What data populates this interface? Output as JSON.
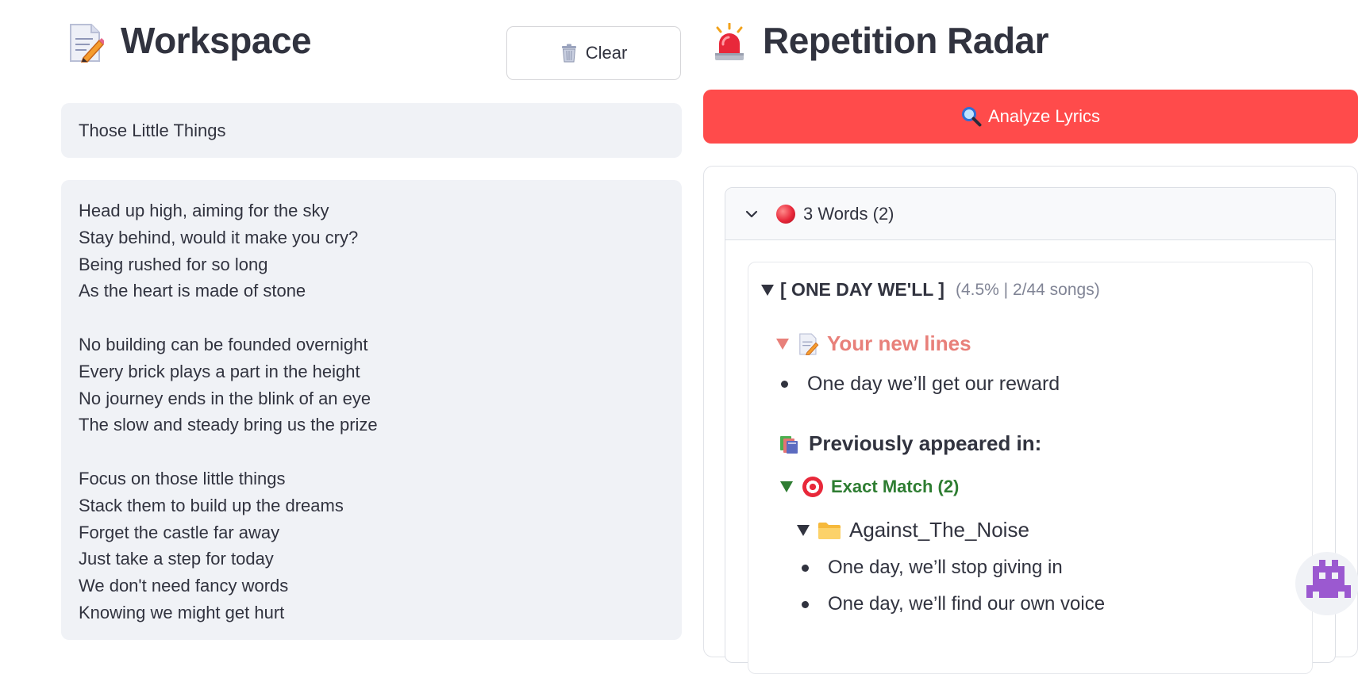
{
  "workspace": {
    "title": "Workspace",
    "icon": "memo-pencil-icon",
    "clear_label": "Clear",
    "song_title_value": "Those Little Things",
    "lyrics_lines": [
      "Head up high, aiming for the sky",
      "Stay behind, would it make you cry?",
      "Being rushed for so long",
      "As the heart is made of stone",
      "",
      "No building can be founded overnight",
      "Every brick plays a part in the height",
      "No journey ends in the blink of an eye",
      "The slow and steady bring us the prize",
      "",
      "Focus on those little things",
      "Stack them to build up the dreams",
      "Forget the castle far away",
      "Just take a step for today",
      "We don't need fancy words",
      "Knowing we might get hurt"
    ]
  },
  "radar": {
    "title": "Repetition Radar",
    "icon": "siren-icon",
    "analyze_label": "Analyze Lyrics",
    "expander_label": "3 Words (2)",
    "phrase_title": "[ ONE DAY WE'LL ]",
    "phrase_meta": "(4.5% | 2/44 songs)",
    "new_lines_label": "Your new lines",
    "new_lines": [
      "One day we’ll get our reward"
    ],
    "previously_label": "Previously appeared in:",
    "exact_match_label": "Exact Match (2)",
    "folder_label": "Against_The_Noise",
    "songs": [
      "One day, we’ll stop giving in",
      "One day, we’ll find our own voice"
    ]
  },
  "colors": {
    "primary": "#ff4b4b",
    "text": "#31333f",
    "input_bg": "#f0f2f6",
    "new_lines": "#e8807a",
    "exact_match": "#2e7d32",
    "muted": "#808495"
  }
}
